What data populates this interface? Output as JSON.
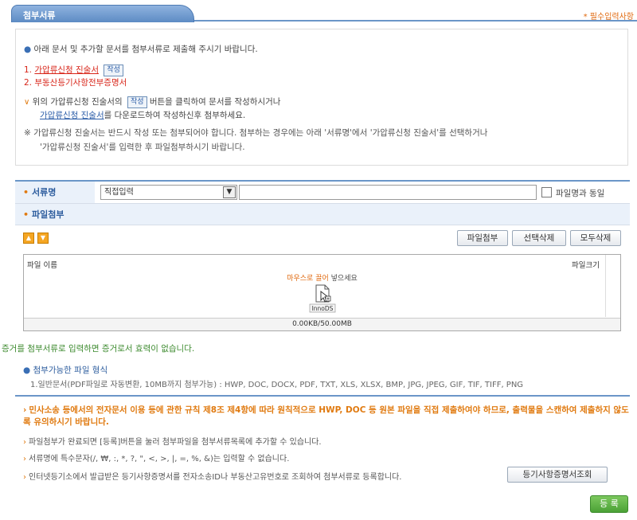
{
  "header": {
    "title": "첨부서류",
    "required_note": "* 필수입력사항"
  },
  "notice": {
    "intro": "아래 문서 및 추가할 문서를 첨부서류로 제출해 주시기 바랍니다.",
    "item1_num": "1.",
    "item1_link": "가압류신청 진술서",
    "item1_btn": "작성",
    "item2": "2. 부동산등기사항전부증명서",
    "guide1_pre": "위의 가압류신청 진술서의",
    "guide1_btn": "작성",
    "guide1_post": "버튼을 클릭하여 문서를 작성하시거나",
    "guide2_link": "가압류신청 진술서",
    "guide2_post": "를 다운로드하여 작성하신후 첨부하세요.",
    "remark1": "※ 가압류신청 진술서는 반드시 작성 또는 첨부되어야 합니다. 첨부하는 경우에는 아래 '서류명'에서 '가압류신청 진술서'를 선택하거나",
    "remark2": "'가압류신청 진술서'를 입력한 후 파일첨부하시기 바랍니다."
  },
  "form": {
    "doc_name_label": "서류명",
    "doc_select_value": "직접입력",
    "doc_name_input": "",
    "same_as_file_label": "파일명과 동일",
    "attach_label": "파일첨부"
  },
  "attach": {
    "buttons": {
      "attach": "파일첨부",
      "delete_selected": "선택삭제",
      "delete_all": "모두삭제"
    },
    "col_filename": "파일 이름",
    "col_filesize": "파일크기",
    "drop_hint_orange": "마우스로 끌어",
    "drop_hint_rest": "넣으세요",
    "icon_label": "InnoDS",
    "usage": "0.00KB/50.00MB"
  },
  "evidence_warning": "증거를 첨부서류로 입력하면 증거로서 효력이 없습니다.",
  "file_types": {
    "title": "첨부가능한 파일 형식",
    "value": "1.일반문서(PDF파일로 자동변환, 10MB까지 첨부가능) : HWP, DOC, DOCX, PDF, TXT, XLS, XLSX, BMP, JPG, JPEG, GIF, TIF, TIFF, PNG"
  },
  "notes": {
    "bold": "민사소송 등에서의 전자문서 이용 등에 관한 규칙 제8조 제4항에 따라 원칙적으로 HWP, DOC 등 원본 파일을 직접 제출하여야 하므로, 출력물을 스캔하여 제출하지 않도록 유의하시기 바랍니다.",
    "n1": "파일첨부가 완료되면 [등록]버튼을 눌러 첨부파일을 첨부서류목록에 추가할 수 있습니다.",
    "n2": "서류명에 특수문자(/, ₩, :, *, ?, \", <, >, |, =, %, &)는 입력할 수 없습니다.",
    "n3": "인터넷등기소에서 발급받은 등기사항증명서를 전자소송ID나 부동산고유번호로 조회하여 첨부서류로 등록합니다.",
    "lookup_btn": "등기사항증명서조회"
  },
  "submit_label": "등 록",
  "colors": {
    "accent_blue": "#6b96c8",
    "orange": "#e07a10",
    "red": "#d8261a",
    "green": "#4ba136"
  }
}
